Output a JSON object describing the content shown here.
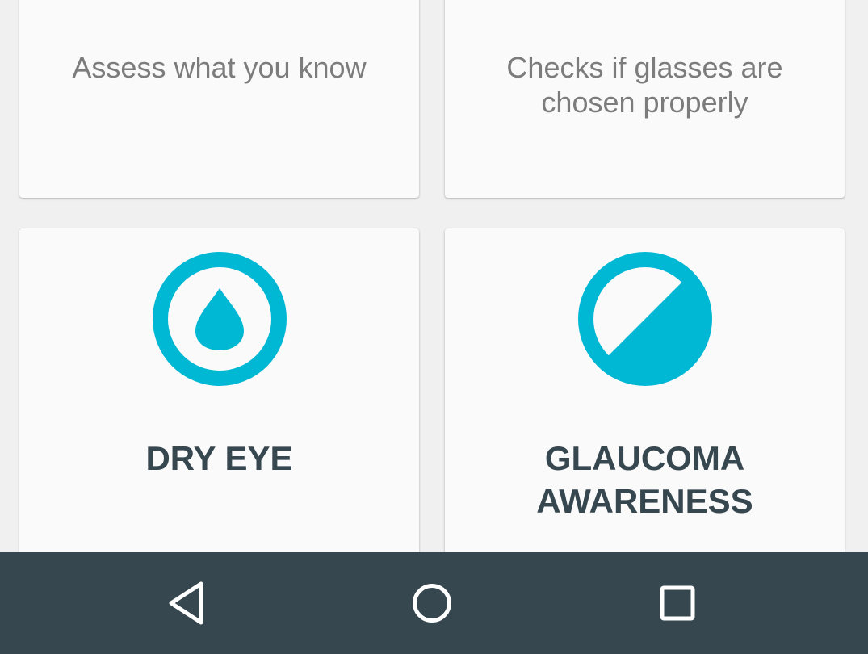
{
  "cards": [
    {
      "description": "Assess what you know"
    },
    {
      "description": "Checks if glasses are\nchosen properly"
    },
    {
      "icon": "droplet-in-circle-icon",
      "title": "DRY EYE"
    },
    {
      "icon": "half-filled-circle-icon",
      "title": "GLAUCOMA\nAWARENESS"
    }
  ],
  "navbar": {
    "back_icon": "back-triangle-icon",
    "home_icon": "home-circle-icon",
    "recents_icon": "recents-square-icon"
  },
  "colors": {
    "accent": "#00b8d4",
    "title_text": "#37474f",
    "description_text": "#7c7c7c",
    "card_background": "#fafafa",
    "page_background": "#f0f0f0",
    "navbar_background": "#37474f",
    "navbar_icon": "#ffffff"
  }
}
